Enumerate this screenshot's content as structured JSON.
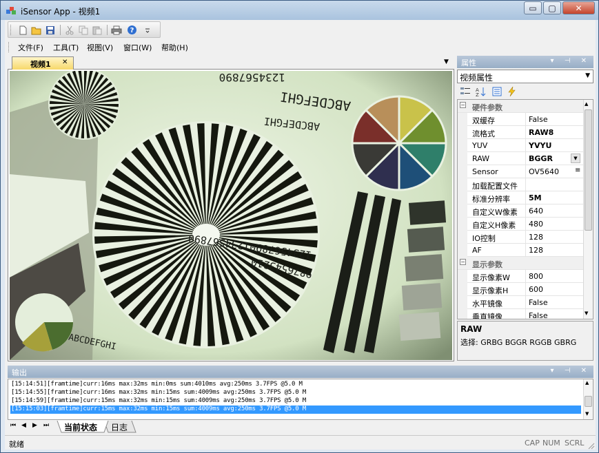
{
  "window": {
    "title": "iSensor App - 视频1",
    "minimize_glyph": "▭",
    "maximize_glyph": "▢",
    "close_glyph": "✕"
  },
  "toolbar": {
    "buttons": [
      "new-file-icon",
      "open-folder-icon",
      "save-icon",
      "cut-icon",
      "copy-icon",
      "paste-icon",
      "print-icon",
      "help-icon"
    ]
  },
  "menu": {
    "items": [
      "文件(F)",
      "工具(T)",
      "视图(V)",
      "窗口(W)",
      "帮助(H)"
    ]
  },
  "document": {
    "tab_label": "视频1",
    "tab_close": "✕",
    "dropdown_glyph": "▼"
  },
  "properties": {
    "title": "属性",
    "pin_glyph": "▾ ⊣ ✕",
    "selector_value": "视频属性",
    "categories": [
      {
        "name": "硬件参数",
        "rows": [
          {
            "name": "双缓存",
            "value": "False",
            "bold": false
          },
          {
            "name": "流格式",
            "value": "RAW8",
            "bold": true
          },
          {
            "name": "YUV",
            "value": "YVYU",
            "bold": true
          },
          {
            "name": "RAW",
            "value": "BGGR",
            "bold": true
          },
          {
            "name": "Sensor",
            "value": "OV5640",
            "bold": false
          },
          {
            "name": "加载配置文件",
            "value": "",
            "bold": false
          },
          {
            "name": "标准分辨率",
            "value": "5M",
            "bold": true
          },
          {
            "name": "自定义W像素",
            "value": "640",
            "bold": false
          },
          {
            "name": "自定义H像素",
            "value": "480",
            "bold": false
          },
          {
            "name": "IO控制",
            "value": "128",
            "bold": false
          },
          {
            "name": "AF",
            "value": "128",
            "bold": false
          }
        ]
      },
      {
        "name": "显示参数",
        "rows": [
          {
            "name": "显示像素W",
            "value": "800",
            "bold": false
          },
          {
            "name": "显示像素H",
            "value": "600",
            "bold": false
          },
          {
            "name": "水平镜像",
            "value": "False",
            "bold": false
          },
          {
            "name": "垂直镜像",
            "value": "False",
            "bold": false
          }
        ]
      }
    ],
    "description": {
      "title": "RAW",
      "text": "选择: GRBG BGGR RGGB GBRG"
    }
  },
  "output": {
    "title": "输出",
    "lines": [
      "[15:14:51][framtime]curr:16ms max:32ms min:0ms sum:4010ms avg:250ms 3.7FPS @5.0 M",
      "[15:14:55][framtime]curr:16ms max:32ms min:15ms sum:4009ms avg:250ms 3.7FPS @5.0 M",
      "[15:14:59][framtime]curr:15ms max:32ms min:15ms sum:4009ms avg:250ms 3.7FPS @5.0 M",
      "[15:15:03][framtime]curr:15ms max:32ms min:15ms sum:4009ms avg:250ms 3.7FPS @5.0 M"
    ],
    "selected_index": 3
  },
  "bottom_tabs": {
    "nav": [
      "⏮",
      "◀",
      "▶",
      "⏭"
    ],
    "tabs": [
      "当前状态",
      "日志"
    ],
    "active": 0
  },
  "status": {
    "text": "就绪",
    "keys": [
      "CAP",
      "NUM",
      "SCRL"
    ]
  },
  "camera": {
    "chart_text_top": "1234567890",
    "alphabet_top": "ABCDEFGHI",
    "alphabet_bottom": "ABCDEFGHI",
    "center_digits": "12345678901234567890",
    "lower_digits": "9876543210"
  },
  "colors": {
    "selection": "#3399ff",
    "title_gradient_top": "#c9daec",
    "panel_header": "#98aec6"
  }
}
